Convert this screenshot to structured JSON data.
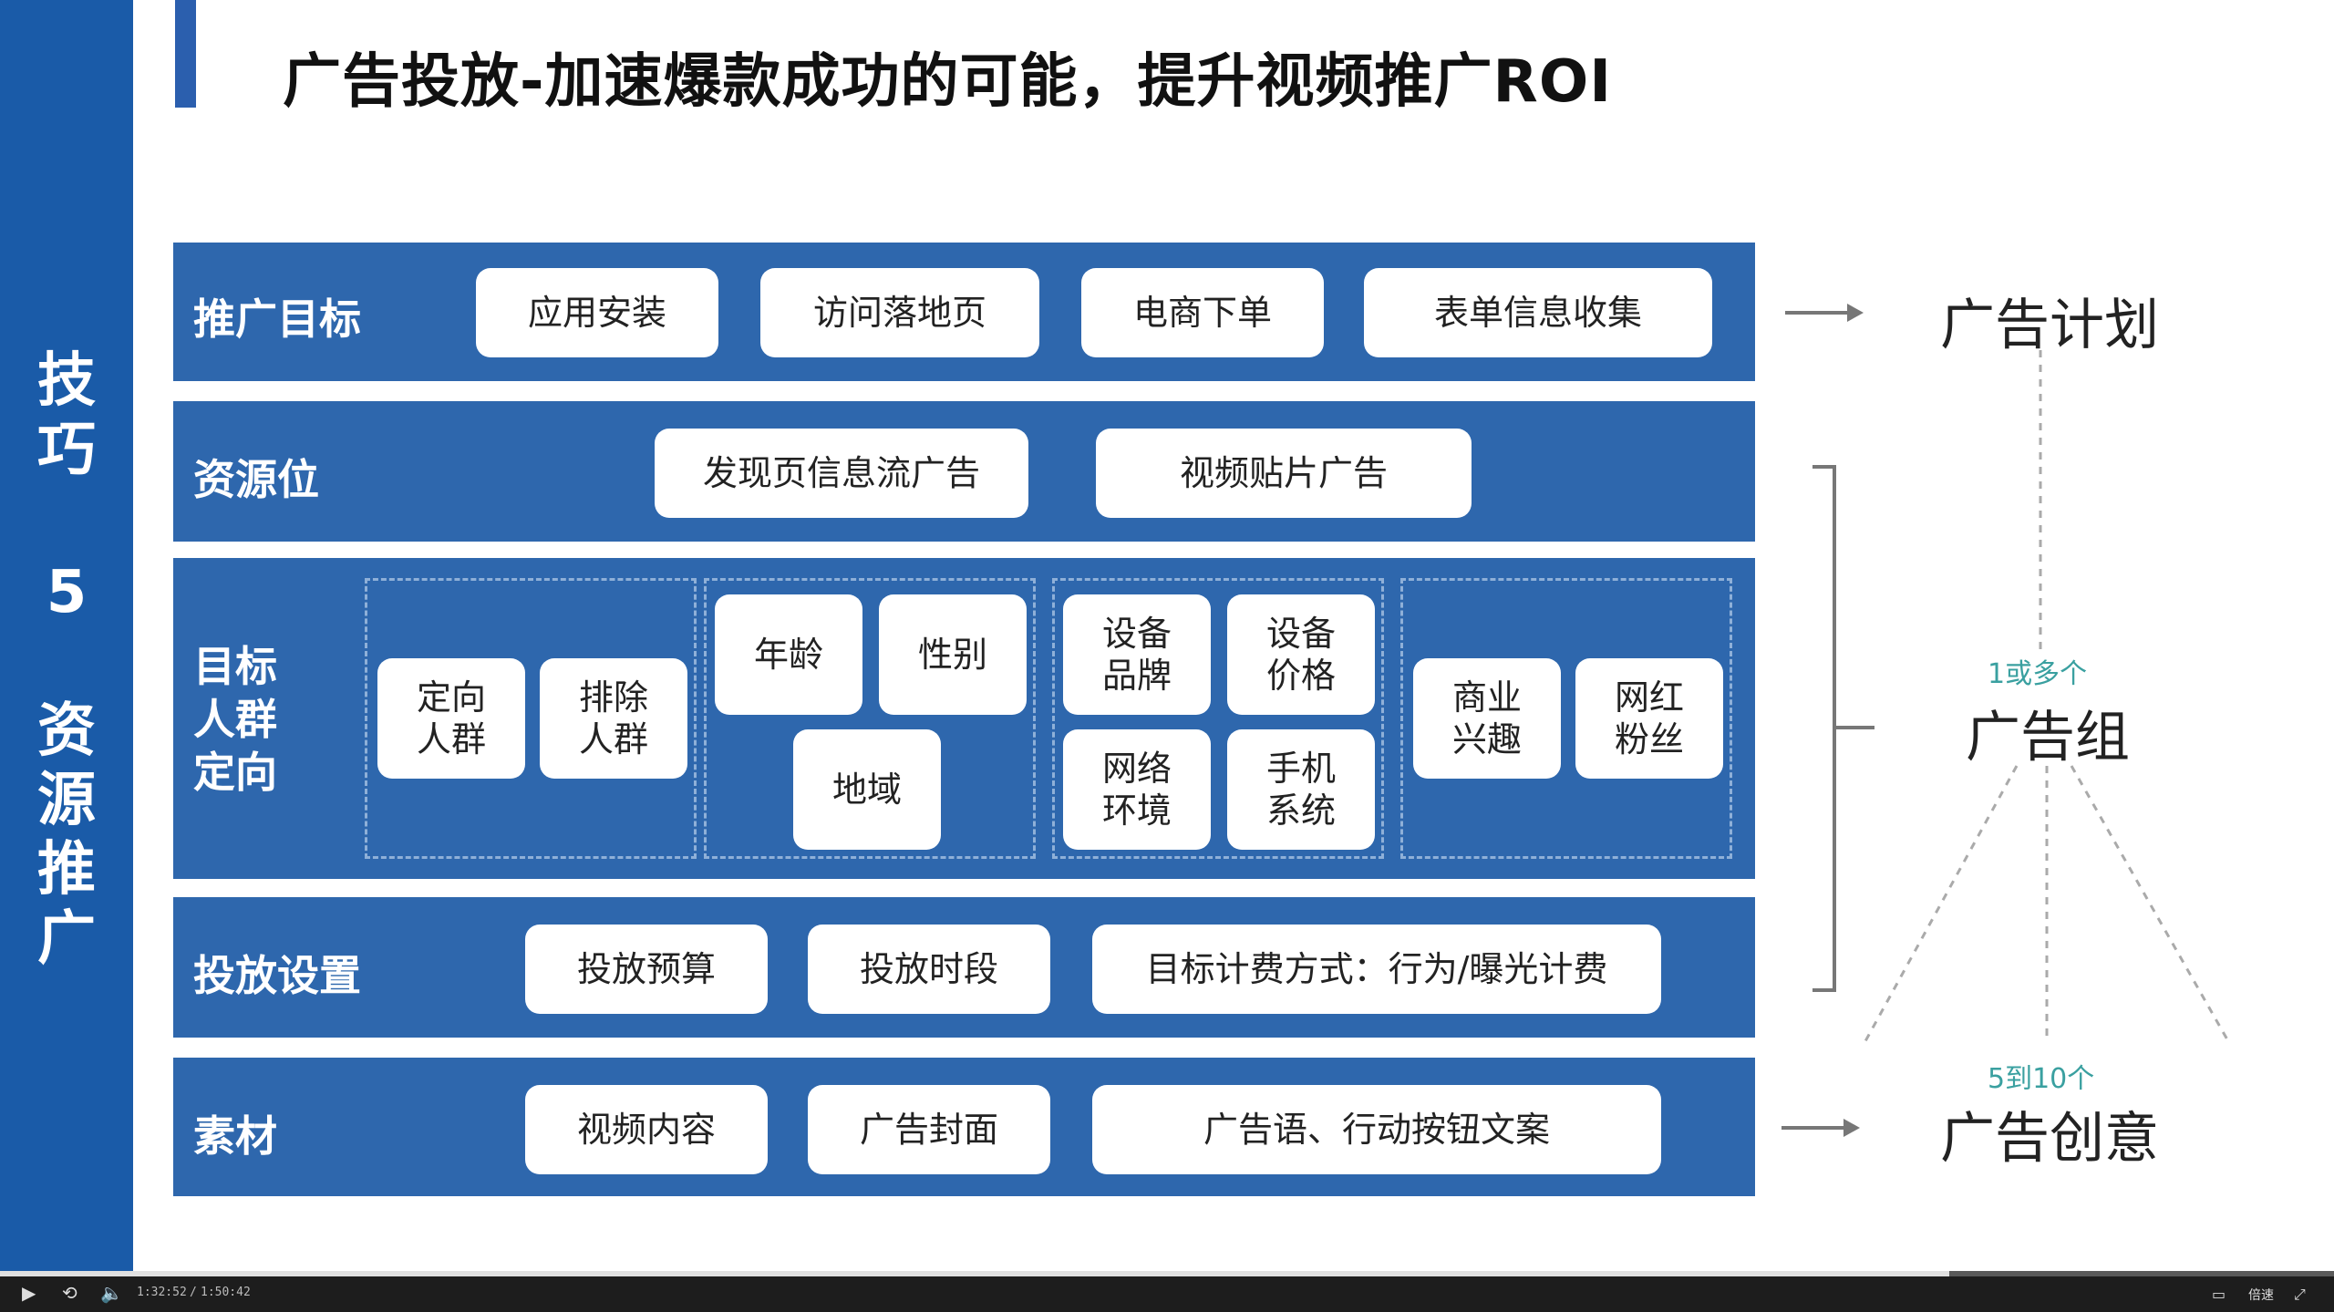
{
  "slide": {
    "side_top": [
      "技",
      "巧"
    ],
    "side_num": "5",
    "side_bottom": [
      "资",
      "源",
      "推",
      "广"
    ],
    "title": "广告投放-加速爆款成功的可能，提升视频推广ROI"
  },
  "rows": {
    "r1": {
      "label": "推广目标",
      "items": [
        "应用安装",
        "访问落地页",
        "电商下单",
        "表单信息收集"
      ]
    },
    "r2": {
      "label": "资源位",
      "items": [
        "发现页信息流广告",
        "视频贴片广告"
      ]
    },
    "r3": {
      "label": "目标\n人群\n定向",
      "items": [
        "定向\n人群",
        "排除\n人群",
        "年龄",
        "性别",
        "地域",
        "设备\n品牌",
        "设备\n价格",
        "网络\n环境",
        "手机\n系统",
        "商业\n兴趣",
        "网红\n粉丝"
      ]
    },
    "r4": {
      "label": "投放设置",
      "items": [
        "投放预算",
        "投放时段",
        "目标计费方式：行为/曝光计费"
      ]
    },
    "r5": {
      "label": "素材",
      "items": [
        "视频内容",
        "广告封面",
        "广告语、行动按钮文案"
      ]
    }
  },
  "right": {
    "plan": "广告计划",
    "group_count": "1或多个",
    "group": "广告组",
    "creative_count": "5到10个",
    "creative": "广告创意"
  },
  "player": {
    "current": "1:32:52",
    "total": "1:50:42",
    "speed": "倍速",
    "progress": 0.835
  },
  "colors": {
    "banner": "#1a5ba8",
    "row": "#2e67ad",
    "accent_text": "#3aa0a0"
  }
}
